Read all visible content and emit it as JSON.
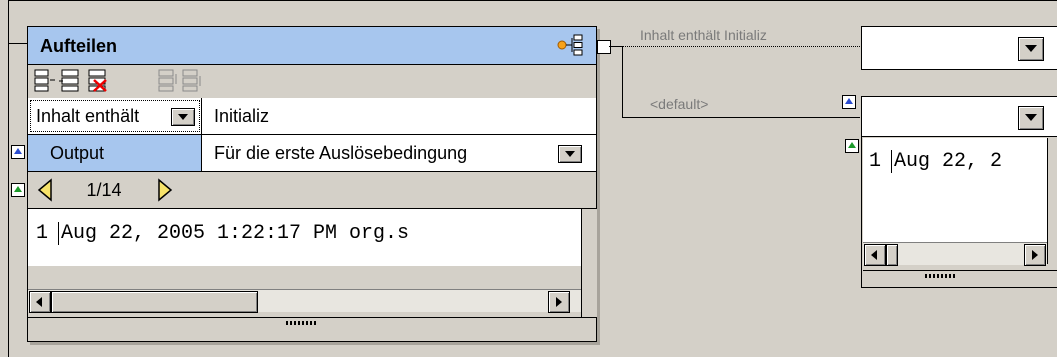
{
  "component": {
    "title": "Aufteilen",
    "row1": {
      "label": "Inhalt enthält",
      "value": "Initializ"
    },
    "row2": {
      "label": "Output",
      "value": "Für die erste Auslösebedingung"
    },
    "pager": "1/14",
    "preview": {
      "line_number": "1",
      "text": "Aug 22, 2005 1:22:17 PM org.s"
    }
  },
  "connections": {
    "top_label": "Inhalt enthält Initializ",
    "bottom_label": "<default>"
  },
  "right_preview": {
    "line_number": "1",
    "text": "Aug 22, 2"
  },
  "icons": [
    "split-component-icon",
    "toolbar-insert-icon",
    "toolbar-append-icon",
    "toolbar-delete-icon",
    "toolbar-move-up-icon",
    "toolbar-move-down-icon",
    "prev-arrow-icon",
    "next-arrow-icon",
    "dropdown-arrow-icon"
  ],
  "colors": {
    "title_bar": "#a7c6ee",
    "background": "#d4d0c8"
  }
}
